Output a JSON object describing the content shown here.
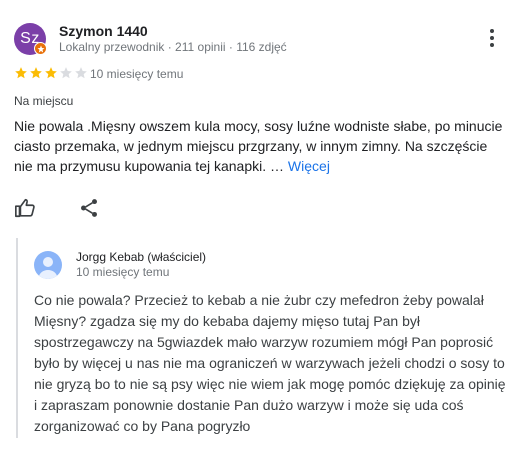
{
  "review": {
    "author": {
      "initials": "Sz",
      "name": "Szymon 1440",
      "meta": "Lokalny przewodnik · 211 opinii · 116 zdjęć"
    },
    "rating": 3,
    "max_rating": 5,
    "time": "10 miesięcy temu",
    "service_type": "Na miejscu",
    "text": "Nie powala .Mięsny owszem kula mocy, sosy luźne wodniste słabe, po minucie ciasto przemaka, w jednym miejscu przgrzany, w innym zimny. Na szczęście nie ma przymusu kupowania tej kanapki. …",
    "more_label": "Więcej"
  },
  "owner_reply": {
    "name": "Jorgg Kebab (właściciel)",
    "time": "10 miesięcy temu",
    "text": "Co nie powala? Przecież to kebab a nie żubr czy mefedron żeby powalał Mięsny? zgadza się my do kebaba dajemy mięso tutaj Pan był spostrzegawczy na 5gwiazdek mało warzyw rozumiem mógł Pan poprosić było by więcej u nas nie ma ograniczeń w warzywach jeżeli chodzi o sosy to nie gryzą bo to nie są psy więc nie wiem jak mogę pomóc dziękuję za opinię i zapraszam ponownie dostanie Pan dużo warzyw i może się uda coś zorganizować co by Pana pogryzło"
  },
  "colors": {
    "avatar": "#7b3fa8",
    "star_filled": "#fbbc04",
    "star_empty": "#dadce0",
    "link": "#1a73e8",
    "owner_avatar": "#8ab4f8"
  },
  "icons": {
    "more": "more-vert-icon",
    "like": "thumb-up-icon",
    "share": "share-icon",
    "guide_badge": "local-guide-badge-icon"
  }
}
